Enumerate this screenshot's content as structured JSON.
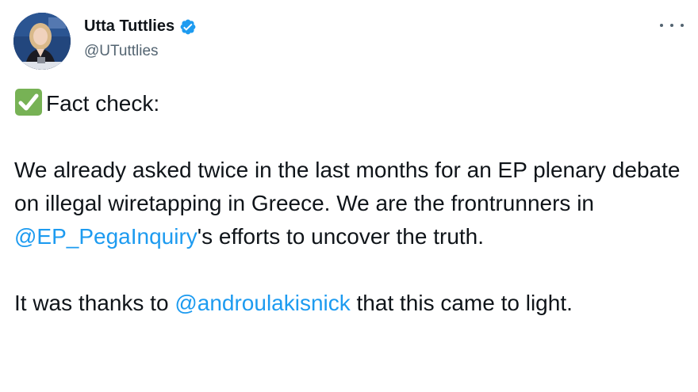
{
  "author": {
    "name": "Utta Tuttlies",
    "handle": "@UTuttlies",
    "verified": true,
    "avatar_icon": "profile-photo"
  },
  "menu": {
    "icon": "more-horizontal-icon"
  },
  "tweet": {
    "heading_emoji": "check-mark-button-emoji",
    "heading_text": "Fact check:",
    "p1_before": "We already asked twice in the last months for an EP plenary debate on illegal wiretapping in Greece. We are the frontrunners in ",
    "p1_mention": "@EP_PegaInquiry",
    "p1_after": "'s efforts to uncover the truth.",
    "p2_before": "It was thanks to ",
    "p2_mention": "@androulakisnick",
    "p2_after": " that this came to light."
  },
  "colors": {
    "text": "#0f1419",
    "secondary": "#536471",
    "link": "#1d9bf0",
    "verified": "#1d9bf0",
    "check_green": "#77b255"
  }
}
